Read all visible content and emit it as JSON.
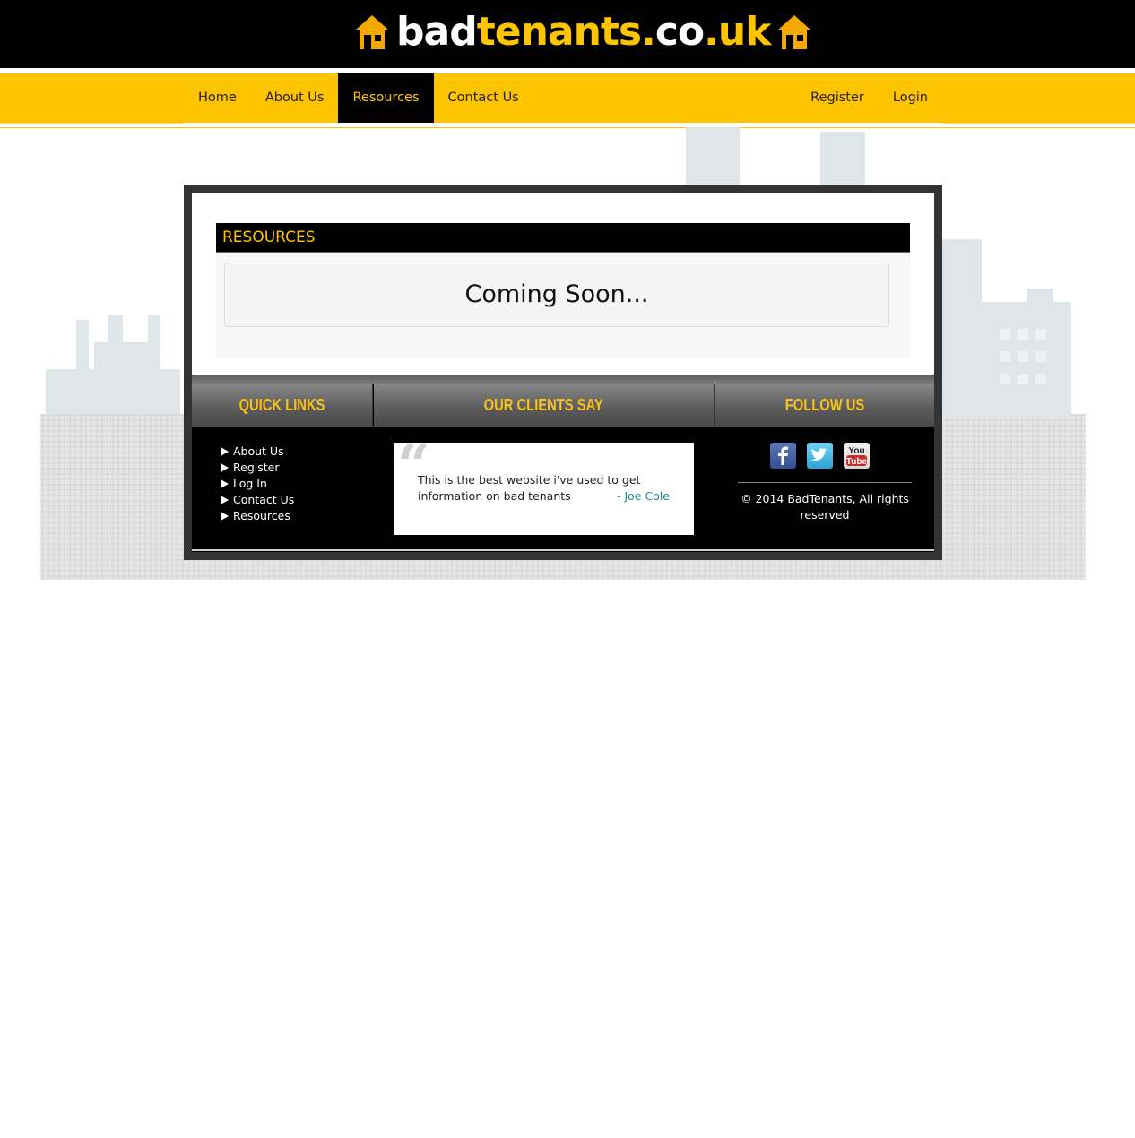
{
  "header": {
    "logo_part1": "bad",
    "logo_part2": "tenants.",
    "logo_part3": "co",
    "logo_part4": ".uk"
  },
  "nav": {
    "left": [
      {
        "label": "Home"
      },
      {
        "label": "About Us"
      },
      {
        "label": "Resources",
        "active": true
      },
      {
        "label": "Contact Us"
      }
    ],
    "right": [
      {
        "label": "Register"
      },
      {
        "label": "Login"
      }
    ]
  },
  "main": {
    "section_title": "RESOURCES",
    "message": "Coming Soon..."
  },
  "footer": {
    "quick_links_title": "QUICK LINKS",
    "clients_title": "OUR CLIENTS SAY",
    "follow_title": "FOLLOW US",
    "quick_links": [
      "About Us",
      "Register",
      "Log In",
      "Contact Us",
      "Resources"
    ],
    "testimonial": {
      "text": "This is the best website i've used to get information on bad tenants",
      "author": "- Joe Cole"
    },
    "social_icons": [
      "facebook-icon",
      "twitter-icon",
      "youtube-icon"
    ],
    "copyright": "© 2014 BadTenants, All rights reserved"
  },
  "colors": {
    "accent": "#ffc400",
    "header_bg": "#000000",
    "author": "#1e8c8a"
  }
}
